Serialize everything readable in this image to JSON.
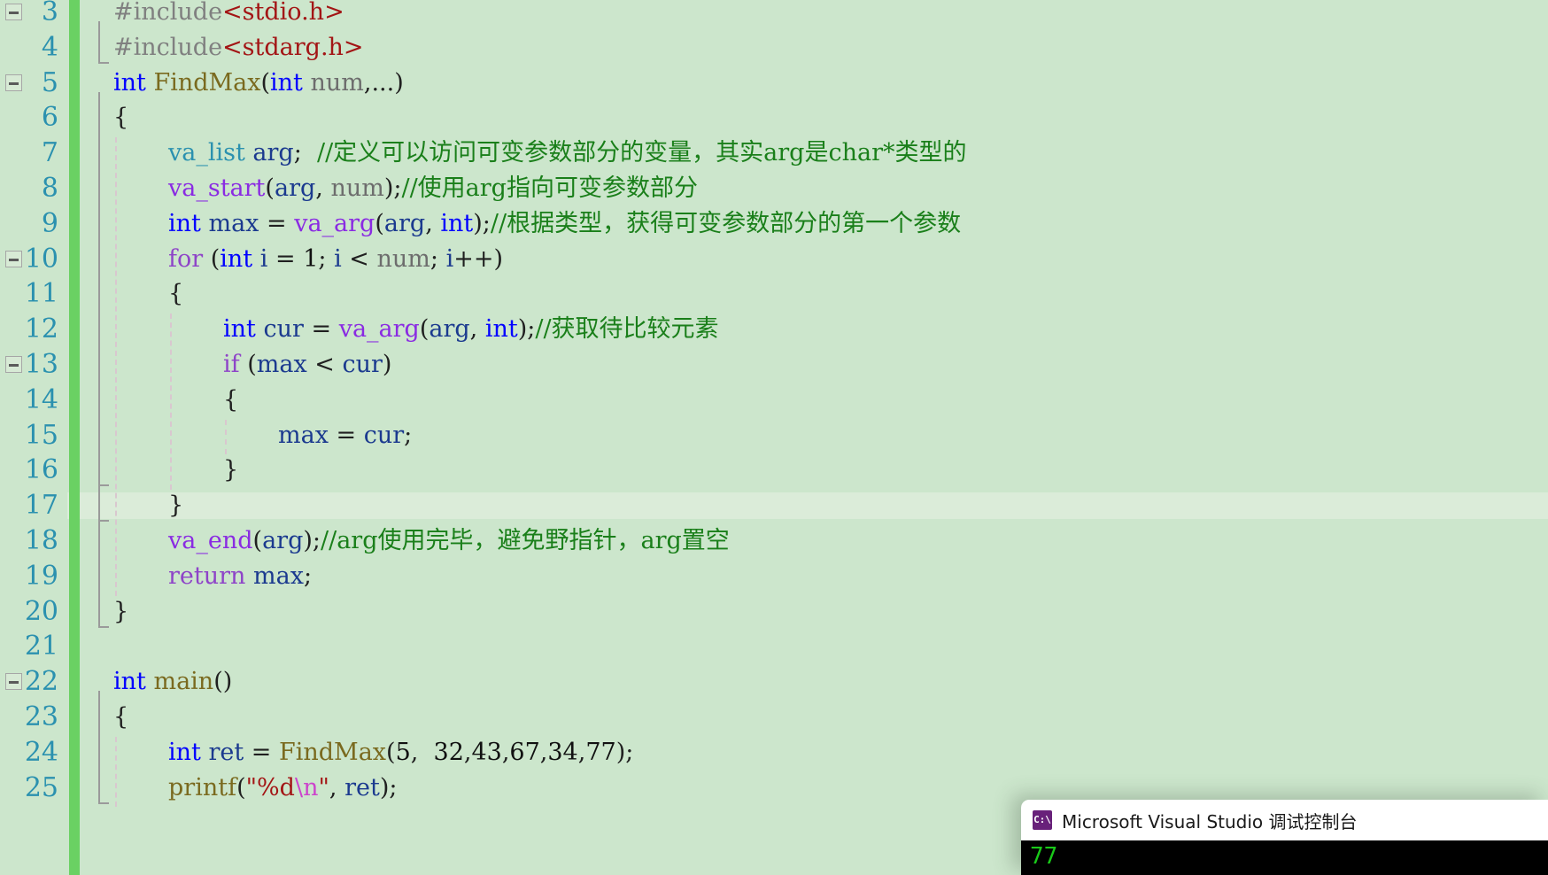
{
  "editor": {
    "language": "C",
    "background_color": "#cce6cc",
    "line_number_color": "#2b91af",
    "change_bar_color": "#6ad163",
    "current_line": 17,
    "current_line_highlight_color": "#dbecd9",
    "first_visible_line": 3,
    "last_visible_line": 25,
    "line_numbers": [
      "3",
      "4",
      "5",
      "6",
      "7",
      "8",
      "9",
      "10",
      "11",
      "12",
      "13",
      "14",
      "15",
      "16",
      "17",
      "18",
      "19",
      "20",
      "21",
      "22",
      "23",
      "24",
      "25"
    ],
    "lines": [
      {
        "n": "3",
        "indent": 0,
        "segments": [
          {
            "t": "#include",
            "c": "pp"
          },
          {
            "t": "<stdio.h>",
            "c": "str"
          }
        ]
      },
      {
        "n": "4",
        "indent": 0,
        "segments": [
          {
            "t": "#include",
            "c": "pp"
          },
          {
            "t": "<stdarg.h>",
            "c": "str"
          }
        ]
      },
      {
        "n": "5",
        "indent": 0,
        "segments": [
          {
            "t": "int",
            "c": "kw"
          },
          {
            "t": " ",
            "c": "pun"
          },
          {
            "t": "FindMax",
            "c": "fn"
          },
          {
            "t": "(",
            "c": "pun"
          },
          {
            "t": "int",
            "c": "kw"
          },
          {
            "t": " ",
            "c": "pun"
          },
          {
            "t": "num",
            "c": "idg"
          },
          {
            "t": ",...)",
            "c": "pun"
          }
        ]
      },
      {
        "n": "6",
        "indent": 0,
        "segments": [
          {
            "t": "{",
            "c": "pun"
          }
        ]
      },
      {
        "n": "7",
        "indent": 1,
        "segments": [
          {
            "t": "va_list",
            "c": "typ"
          },
          {
            "t": " ",
            "c": "pun"
          },
          {
            "t": "arg",
            "c": "id"
          },
          {
            "t": ";  ",
            "c": "pun"
          },
          {
            "t": "//定义可以访问可变参数部分的变量，其实arg是char*类型的",
            "c": "cmt"
          }
        ]
      },
      {
        "n": "8",
        "indent": 1,
        "segments": [
          {
            "t": "va_start",
            "c": "macro"
          },
          {
            "t": "(",
            "c": "pun"
          },
          {
            "t": "arg",
            "c": "id"
          },
          {
            "t": ", ",
            "c": "pun"
          },
          {
            "t": "num",
            "c": "idg"
          },
          {
            "t": ");",
            "c": "pun"
          },
          {
            "t": "//使用arg指向可变参数部分",
            "c": "cmt"
          }
        ]
      },
      {
        "n": "9",
        "indent": 1,
        "segments": [
          {
            "t": "int",
            "c": "kw"
          },
          {
            "t": " ",
            "c": "pun"
          },
          {
            "t": "max",
            "c": "id"
          },
          {
            "t": " = ",
            "c": "pun"
          },
          {
            "t": "va_arg",
            "c": "macro"
          },
          {
            "t": "(",
            "c": "pun"
          },
          {
            "t": "arg",
            "c": "id"
          },
          {
            "t": ", ",
            "c": "pun"
          },
          {
            "t": "int",
            "c": "kw"
          },
          {
            "t": ");",
            "c": "pun"
          },
          {
            "t": "//根据类型，获得可变参数部分的第一个参数",
            "c": "cmt"
          }
        ]
      },
      {
        "n": "10",
        "indent": 1,
        "segments": [
          {
            "t": "for",
            "c": "kwret"
          },
          {
            "t": " (",
            "c": "pun"
          },
          {
            "t": "int",
            "c": "kw"
          },
          {
            "t": " ",
            "c": "pun"
          },
          {
            "t": "i",
            "c": "id"
          },
          {
            "t": " = ",
            "c": "pun"
          },
          {
            "t": "1",
            "c": "num"
          },
          {
            "t": "; ",
            "c": "pun"
          },
          {
            "t": "i",
            "c": "id"
          },
          {
            "t": " < ",
            "c": "pun"
          },
          {
            "t": "num",
            "c": "idg"
          },
          {
            "t": "; ",
            "c": "pun"
          },
          {
            "t": "i",
            "c": "id"
          },
          {
            "t": "++)",
            "c": "pun"
          }
        ]
      },
      {
        "n": "11",
        "indent": 1,
        "segments": [
          {
            "t": "{",
            "c": "pun"
          }
        ]
      },
      {
        "n": "12",
        "indent": 2,
        "segments": [
          {
            "t": "int",
            "c": "kw"
          },
          {
            "t": " ",
            "c": "pun"
          },
          {
            "t": "cur",
            "c": "id"
          },
          {
            "t": " = ",
            "c": "pun"
          },
          {
            "t": "va_arg",
            "c": "macro"
          },
          {
            "t": "(",
            "c": "pun"
          },
          {
            "t": "arg",
            "c": "id"
          },
          {
            "t": ", ",
            "c": "pun"
          },
          {
            "t": "int",
            "c": "kw"
          },
          {
            "t": ");",
            "c": "pun"
          },
          {
            "t": "//获取待比较元素",
            "c": "cmt"
          }
        ]
      },
      {
        "n": "13",
        "indent": 2,
        "segments": [
          {
            "t": "if",
            "c": "kwret"
          },
          {
            "t": " (",
            "c": "pun"
          },
          {
            "t": "max",
            "c": "id"
          },
          {
            "t": " < ",
            "c": "pun"
          },
          {
            "t": "cur",
            "c": "id"
          },
          {
            "t": ")",
            "c": "pun"
          }
        ]
      },
      {
        "n": "14",
        "indent": 2,
        "segments": [
          {
            "t": "{",
            "c": "pun"
          }
        ]
      },
      {
        "n": "15",
        "indent": 3,
        "segments": [
          {
            "t": "max",
            "c": "id"
          },
          {
            "t": " = ",
            "c": "pun"
          },
          {
            "t": "cur",
            "c": "id"
          },
          {
            "t": ";",
            "c": "pun"
          }
        ]
      },
      {
        "n": "16",
        "indent": 2,
        "segments": [
          {
            "t": "}",
            "c": "pun"
          }
        ]
      },
      {
        "n": "17",
        "indent": 1,
        "segments": [
          {
            "t": "}",
            "c": "pun"
          }
        ]
      },
      {
        "n": "18",
        "indent": 1,
        "segments": [
          {
            "t": "va_end",
            "c": "macro"
          },
          {
            "t": "(",
            "c": "pun"
          },
          {
            "t": "arg",
            "c": "id"
          },
          {
            "t": ");",
            "c": "pun"
          },
          {
            "t": "//arg使用完毕，避免野指针，arg置空",
            "c": "cmt"
          }
        ]
      },
      {
        "n": "19",
        "indent": 1,
        "segments": [
          {
            "t": "return",
            "c": "kwret"
          },
          {
            "t": " ",
            "c": "pun"
          },
          {
            "t": "max",
            "c": "id"
          },
          {
            "t": ";",
            "c": "pun"
          }
        ]
      },
      {
        "n": "20",
        "indent": 0,
        "segments": [
          {
            "t": "}",
            "c": "pun"
          }
        ]
      },
      {
        "n": "21",
        "indent": 0,
        "segments": []
      },
      {
        "n": "22",
        "indent": 0,
        "segments": [
          {
            "t": "int",
            "c": "kw"
          },
          {
            "t": " ",
            "c": "pun"
          },
          {
            "t": "main",
            "c": "fn"
          },
          {
            "t": "()",
            "c": "pun"
          }
        ]
      },
      {
        "n": "23",
        "indent": 0,
        "segments": [
          {
            "t": "{",
            "c": "pun"
          }
        ]
      },
      {
        "n": "24",
        "indent": 1,
        "segments": [
          {
            "t": "int",
            "c": "kw"
          },
          {
            "t": " ",
            "c": "pun"
          },
          {
            "t": "ret",
            "c": "id"
          },
          {
            "t": " = ",
            "c": "pun"
          },
          {
            "t": "FindMax",
            "c": "fn"
          },
          {
            "t": "(",
            "c": "pun"
          },
          {
            "t": "5",
            "c": "num"
          },
          {
            "t": ",  ",
            "c": "pun"
          },
          {
            "t": "32",
            "c": "num"
          },
          {
            "t": ",",
            "c": "pun"
          },
          {
            "t": "43",
            "c": "num"
          },
          {
            "t": ",",
            "c": "pun"
          },
          {
            "t": "67",
            "c": "num"
          },
          {
            "t": ",",
            "c": "pun"
          },
          {
            "t": "34",
            "c": "num"
          },
          {
            "t": ",",
            "c": "pun"
          },
          {
            "t": "77",
            "c": "num"
          },
          {
            "t": ");",
            "c": "pun"
          }
        ]
      },
      {
        "n": "25",
        "indent": 1,
        "segments": [
          {
            "t": "printf",
            "c": "fn"
          },
          {
            "t": "(",
            "c": "pun"
          },
          {
            "t": "\"%d",
            "c": "str"
          },
          {
            "t": "\\n",
            "c": "esc"
          },
          {
            "t": "\"",
            "c": "str"
          },
          {
            "t": ", ",
            "c": "pun"
          },
          {
            "t": "ret",
            "c": "id"
          },
          {
            "t": ");",
            "c": "pun"
          }
        ]
      }
    ],
    "fold_markers": [
      {
        "line": "3",
        "state": "expanded"
      },
      {
        "line": "5",
        "state": "expanded"
      },
      {
        "line": "10",
        "state": "expanded"
      },
      {
        "line": "13",
        "state": "expanded"
      },
      {
        "line": "22",
        "state": "expanded"
      }
    ]
  },
  "console_window": {
    "title": "Microsoft Visual Studio 调试控制台",
    "icon": "console-window-icon",
    "icon_glyph": "C:\\",
    "icon_color": "#68217a",
    "output": "77",
    "output_color": "#19c919",
    "background_color": "#000000",
    "titlebar_color": "#ffffff"
  }
}
